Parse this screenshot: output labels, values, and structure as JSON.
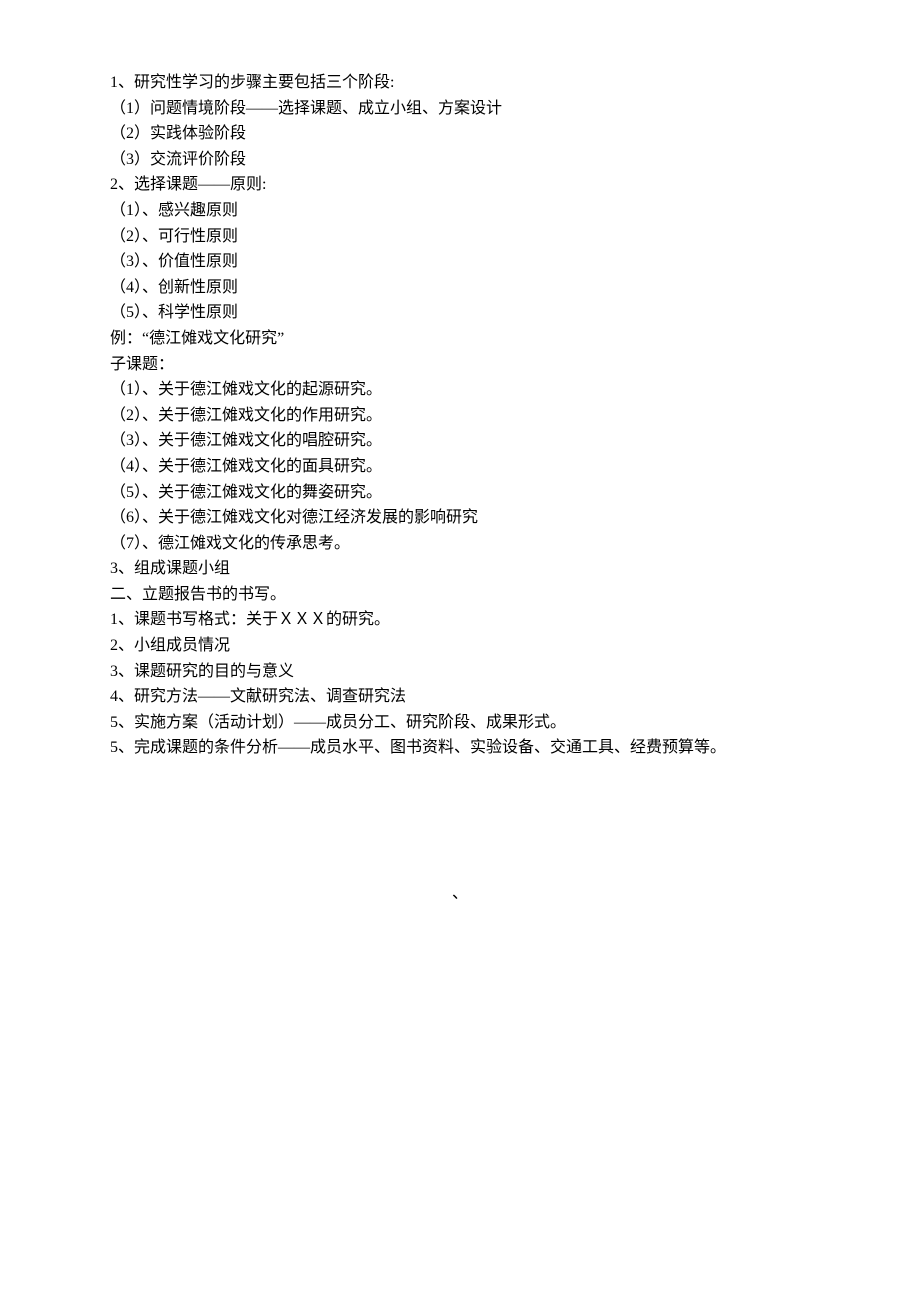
{
  "lines": [
    "1、研究性学习的步骤主要包括三个阶段:",
    "（1）问题情境阶段——选择课题、成立小组、方案设计",
    "（2）实践体验阶段",
    "（3）交流评价阶段",
    "2、选择课题——原则:",
    "（1）、感兴趣原则",
    "（2）、可行性原则",
    "（3）、价值性原则",
    "（4）、创新性原则",
    "（5）、科学性原则",
    "例：“德江傩戏文化研究”",
    "子课题：",
    "（1）、关于德江傩戏文化的起源研究。",
    "（2）、关于德江傩戏文化的作用研究。",
    "（3）、关于德江傩戏文化的唱腔研究。",
    "（4）、关于德江傩戏文化的面具研究。",
    "（5）、关于德江傩戏文化的舞姿研究。",
    "（6）、关于德江傩戏文化对德江经济发展的影响研究",
    "（7）、德江傩戏文化的传承思考。",
    "3、组成课题小组",
    "二、立题报告书的书写。",
    "1、课题书写格式：关于ＸＸＸ的研究。",
    "2、小组成员情况",
    "3、课题研究的目的与意义",
    "4、研究方法——文献研究法、调查研究法",
    "5、实施方案（活动计划）——成员分工、研究阶段、成果形式。",
    "5、完成课题的条件分析——成员水平、图书资料、实验设备、交通工具、经费预算等。"
  ],
  "mark": "、"
}
